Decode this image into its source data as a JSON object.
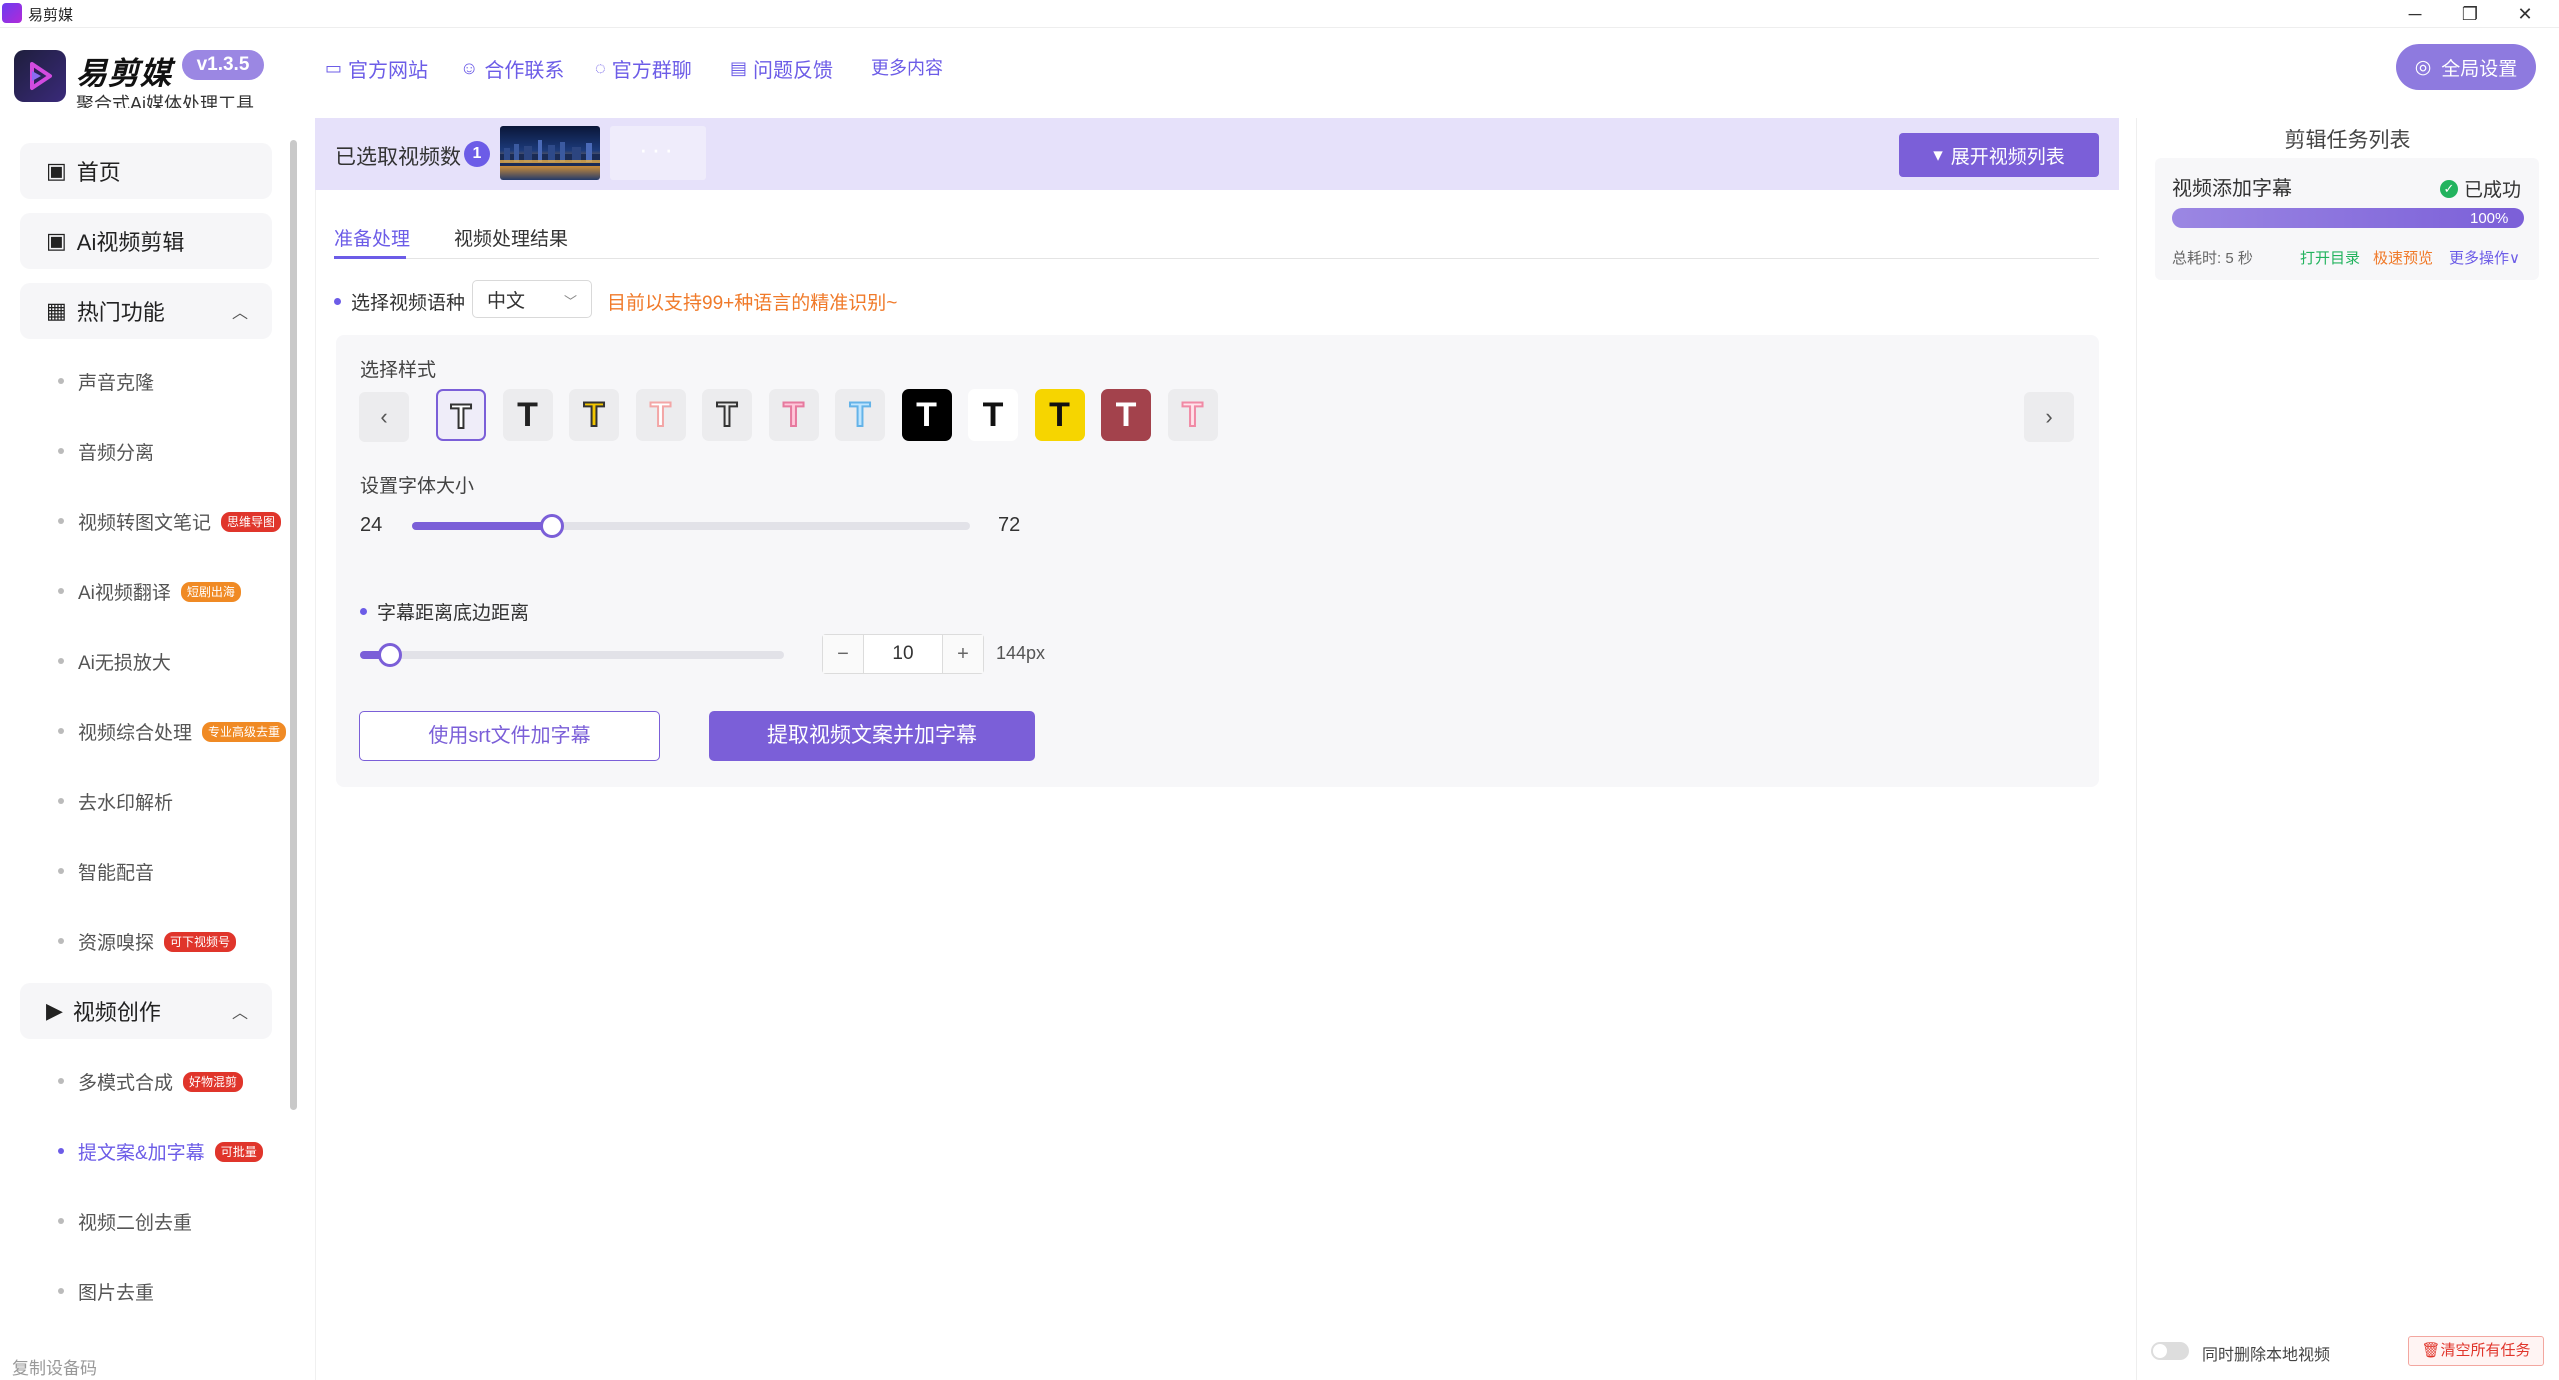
{
  "window": {
    "title": "易剪媒",
    "controls": {
      "minimize": "─",
      "maximize": "❐",
      "close": "✕"
    }
  },
  "header": {
    "brand": "易剪媒",
    "version": "v1.3.5",
    "subtitle": "聚合式Ai媒体处理工具",
    "nav": [
      {
        "icon": "browser-icon",
        "label": "官方网站"
      },
      {
        "icon": "people-icon",
        "label": "合作联系"
      },
      {
        "icon": "chat-icon",
        "label": "官方群聊"
      },
      {
        "icon": "feedback-icon",
        "label": "问题反馈"
      },
      {
        "icon": "",
        "label": "更多内容"
      }
    ],
    "settings_label": "全局设置"
  },
  "sidebar": {
    "main_items": [
      {
        "icon": "clapper-icon",
        "label": "首页"
      },
      {
        "icon": "clapper-icon",
        "label": "Ai视频剪辑"
      },
      {
        "icon": "grid-icon",
        "label": "热门功能"
      },
      {
        "icon": "video-icon",
        "label": "视频创作"
      }
    ],
    "hot_items": [
      {
        "label": "声音克隆",
        "badge": ""
      },
      {
        "label": "音频分离",
        "badge": ""
      },
      {
        "label": "视频转图文笔记",
        "badge": "思维导图"
      },
      {
        "label": "Ai视频翻译",
        "badge": "短剧出海"
      },
      {
        "label": "Ai无损放大",
        "badge": ""
      },
      {
        "label": "视频综合处理",
        "badge": "专业高级去重"
      },
      {
        "label": "去水印解析",
        "badge": ""
      },
      {
        "label": "智能配音",
        "badge": ""
      },
      {
        "label": "资源嗅探",
        "badge": "可下视频号"
      }
    ],
    "create_items": [
      {
        "label": "多模式合成",
        "badge": "好物混剪"
      },
      {
        "label": "提文案&加字幕",
        "badge": "可批量"
      },
      {
        "label": "视频二创去重",
        "badge": ""
      },
      {
        "label": "图片去重",
        "badge": ""
      }
    ],
    "footer": "复制设备码"
  },
  "selection": {
    "label": "已选取视频数",
    "count": "1",
    "more": "···",
    "expand_label": "展开视频列表"
  },
  "tabs": [
    "准备处理",
    "视频处理结果"
  ],
  "language": {
    "label": "选择视频语种",
    "value": "中文",
    "note": "目前以支持99+种语言的精准识别~"
  },
  "style": {
    "label": "选择样式",
    "glyph": "T",
    "prev": "‹",
    "next": "›",
    "options": [
      {
        "fill": "#ffffff",
        "stroke": "#333333",
        "bg": "#efedf9",
        "selected": true
      },
      {
        "fill": "#222222",
        "stroke": "",
        "bg": "#ececee"
      },
      {
        "fill": "#f2c600",
        "stroke": "#333333",
        "bg": "#ececee"
      },
      {
        "fill": "#ffffff",
        "stroke": "#f3a6a6",
        "bg": "#ececee"
      },
      {
        "fill": "#e9e9e9",
        "stroke": "#333333",
        "bg": "#ececee"
      },
      {
        "fill": "#ffc6d9",
        "stroke": "#e6799e",
        "bg": "#ececee"
      },
      {
        "fill": "#bfe6ff",
        "stroke": "#64b3e8",
        "bg": "#ececee"
      },
      {
        "fill": "#ffffff",
        "stroke": "",
        "bg": "#000000"
      },
      {
        "fill": "#111111",
        "stroke": "",
        "bg": "#ffffff"
      },
      {
        "fill": "#111111",
        "stroke": "",
        "bg": "#f6d500"
      },
      {
        "fill": "#ffffff",
        "stroke": "",
        "bg": "#a3424c"
      },
      {
        "fill": "#ffe3ea",
        "stroke": "#f08aa5",
        "bg": "#ececee"
      }
    ]
  },
  "font_size": {
    "label": "设置字体大小",
    "min": "24",
    "max": "72",
    "value_fraction": 0.25
  },
  "bottom_distance": {
    "label": "字幕距离底边距离",
    "value": "10",
    "px": "144px",
    "value_fraction": 0.07,
    "minus": "−",
    "plus": "+"
  },
  "actions": {
    "srt_label": "使用srt文件加字幕",
    "extract_label": "提取视频文案并加字幕"
  },
  "task_panel": {
    "title": "剪辑任务列表",
    "task": {
      "name": "视频添加字幕",
      "status": "已成功",
      "progress": "100%",
      "progress_fraction": 1.0,
      "time": "总耗时: 5 秒"
    },
    "links": [
      {
        "label": "打开目录",
        "color": "#22b35e"
      },
      {
        "label": "极速预览",
        "color": "#f07a2a"
      },
      {
        "label": "更多操作∨",
        "color": "#6c5ce7"
      }
    ],
    "toggle_label": "同时删除本地视频",
    "clear_label": "清空所有任务",
    "clear_icon": "trash-icon"
  },
  "colors": {
    "accent": "#7b5fd8",
    "note": "#f07a2a",
    "success": "#22b35e",
    "danger": "#e0352b"
  }
}
